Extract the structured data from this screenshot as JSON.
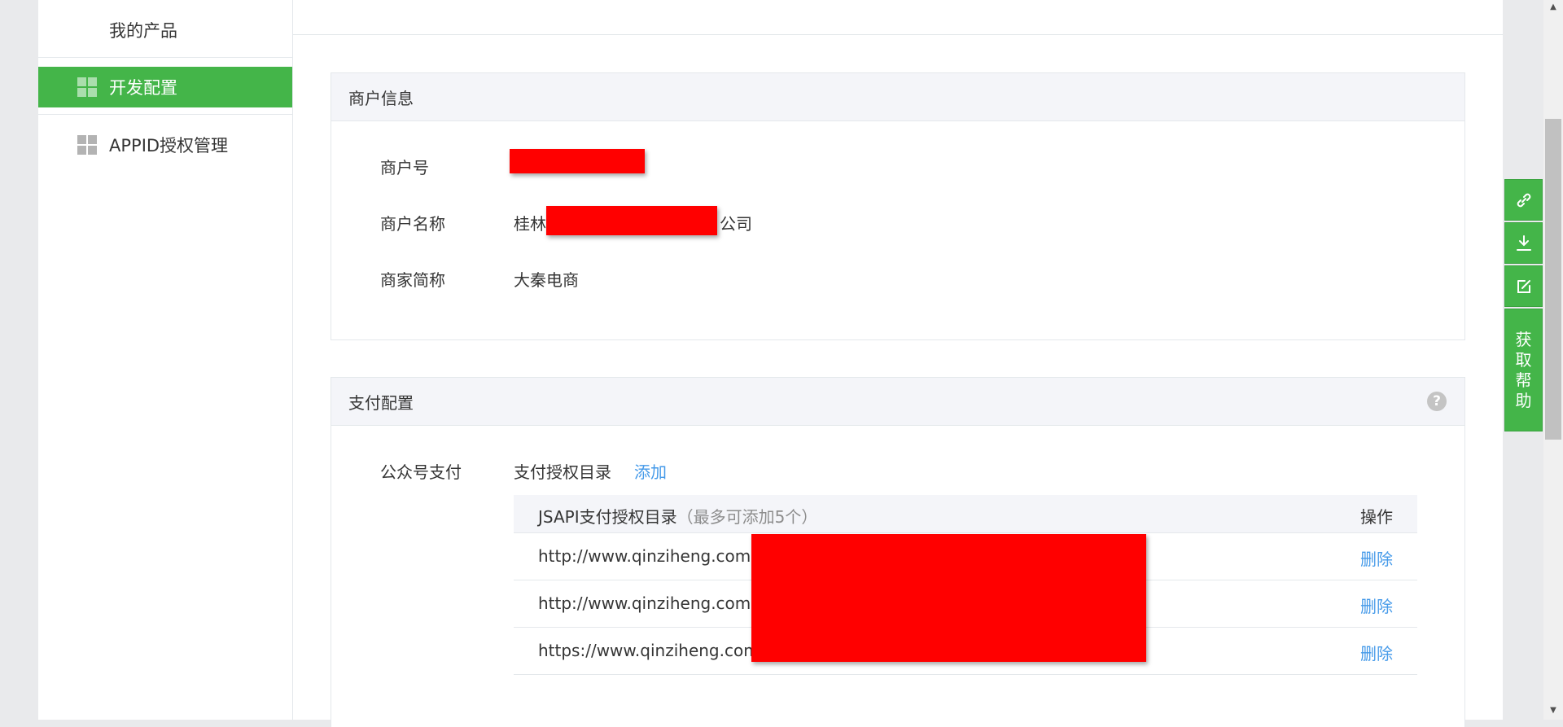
{
  "sidebar": {
    "items": [
      {
        "label": "我的产品"
      },
      {
        "label": "开发配置"
      },
      {
        "label": "APPID授权管理"
      }
    ]
  },
  "merchant": {
    "title": "商户信息",
    "fields": [
      {
        "label": "商户号",
        "value": ""
      },
      {
        "label": "商户名称",
        "prefix": "桂林",
        "suffix": "公司"
      },
      {
        "label": "商家简称",
        "value": "大秦电商"
      }
    ]
  },
  "payment": {
    "title": "支付配置",
    "help_icon_glyph": "?",
    "row_label": "公众号支付",
    "dir_label": "支付授权目录",
    "add_link": "添加",
    "table": {
      "header": "JSAPI支付授权目录",
      "header_hint": "（最多可添加5个）",
      "action_header": "操作",
      "rows": [
        {
          "url": "http://www.qinziheng.com",
          "action": "删除"
        },
        {
          "url": "http://www.qinziheng.com",
          "action": "删除"
        },
        {
          "url": "https://www.qinziheng.com",
          "action": "删除"
        }
      ]
    }
  },
  "float_toolbar": {
    "icons": [
      "link-icon",
      "download-icon",
      "edit-icon"
    ],
    "help_chars": [
      "获",
      "取",
      "帮",
      "助"
    ]
  },
  "colors": {
    "accent_green": "#44b549",
    "link_blue": "#459ae9",
    "redaction": "#ff0000"
  }
}
